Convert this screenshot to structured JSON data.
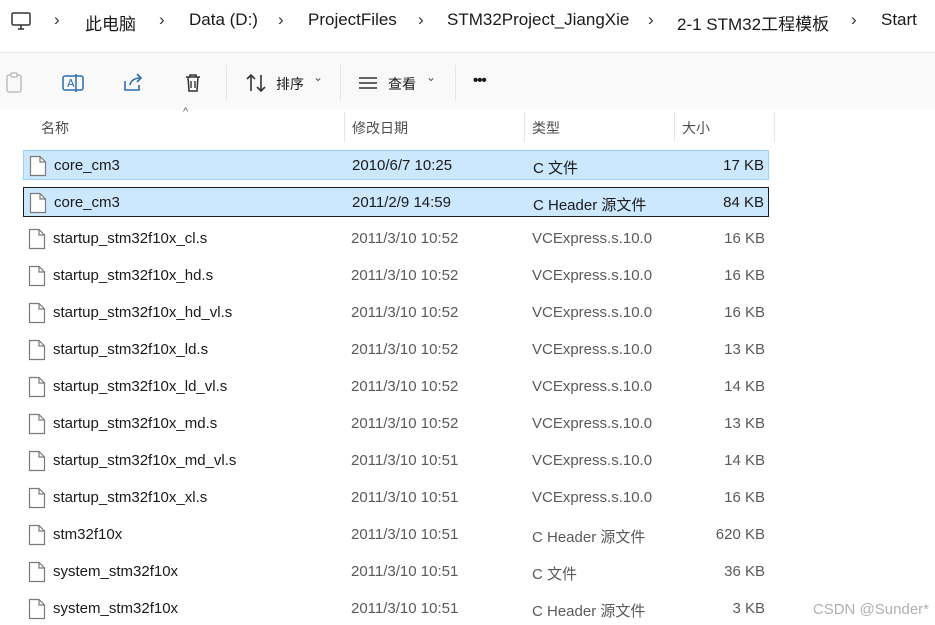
{
  "breadcrumb": {
    "items": [
      "此电脑",
      "Data (D:)",
      "ProjectFiles",
      "STM32Project_JiangXie",
      "2-1 STM32工程模板",
      "Start"
    ],
    "separator": "›"
  },
  "toolbar": {
    "sort_label": "排序",
    "view_label": "查看",
    "more_label": "•••",
    "chevron": "⌄"
  },
  "columns": {
    "name": "名称",
    "date": "修改日期",
    "type": "类型",
    "size": "大小"
  },
  "files": [
    {
      "name": "core_cm3",
      "date": "2010/6/7 10:25",
      "type": "C 文件",
      "size": "17 KB",
      "state": "selected"
    },
    {
      "name": "core_cm3",
      "date": "2011/2/9 14:59",
      "type": "C Header 源文件",
      "size": "84 KB",
      "state": "focused"
    },
    {
      "name": "startup_stm32f10x_cl.s",
      "date": "2011/3/10 10:52",
      "type": "VCExpress.s.10.0",
      "size": "16 KB",
      "state": "normal"
    },
    {
      "name": "startup_stm32f10x_hd.s",
      "date": "2011/3/10 10:52",
      "type": "VCExpress.s.10.0",
      "size": "16 KB",
      "state": "normal"
    },
    {
      "name": "startup_stm32f10x_hd_vl.s",
      "date": "2011/3/10 10:52",
      "type": "VCExpress.s.10.0",
      "size": "16 KB",
      "state": "normal"
    },
    {
      "name": "startup_stm32f10x_ld.s",
      "date": "2011/3/10 10:52",
      "type": "VCExpress.s.10.0",
      "size": "13 KB",
      "state": "normal"
    },
    {
      "name": "startup_stm32f10x_ld_vl.s",
      "date": "2011/3/10 10:52",
      "type": "VCExpress.s.10.0",
      "size": "14 KB",
      "state": "normal"
    },
    {
      "name": "startup_stm32f10x_md.s",
      "date": "2011/3/10 10:52",
      "type": "VCExpress.s.10.0",
      "size": "13 KB",
      "state": "normal"
    },
    {
      "name": "startup_stm32f10x_md_vl.s",
      "date": "2011/3/10 10:51",
      "type": "VCExpress.s.10.0",
      "size": "14 KB",
      "state": "normal"
    },
    {
      "name": "startup_stm32f10x_xl.s",
      "date": "2011/3/10 10:51",
      "type": "VCExpress.s.10.0",
      "size": "16 KB",
      "state": "normal"
    },
    {
      "name": "stm32f10x",
      "date": "2011/3/10 10:51",
      "type": "C Header 源文件",
      "size": "620 KB",
      "state": "normal"
    },
    {
      "name": "system_stm32f10x",
      "date": "2011/3/10 10:51",
      "type": "C 文件",
      "size": "36 KB",
      "state": "normal"
    },
    {
      "name": "system_stm32f10x",
      "date": "2011/3/10 10:51",
      "type": "C Header 源文件",
      "size": "3 KB",
      "state": "normal"
    }
  ],
  "watermark": "CSDN @Sunder*",
  "colors": {
    "selection_bg": "#cce8ff",
    "selection_border": "#99d1ff",
    "focus_border": "#1a1a1a",
    "toolbar_bg": "#f9f9f9"
  },
  "icons": {
    "computer": "computer-icon",
    "paste": "paste-icon",
    "rename": "rename-icon",
    "share": "share-icon",
    "delete": "delete-icon",
    "sort": "sort-icon",
    "view": "view-icon",
    "file": "file-icon"
  }
}
